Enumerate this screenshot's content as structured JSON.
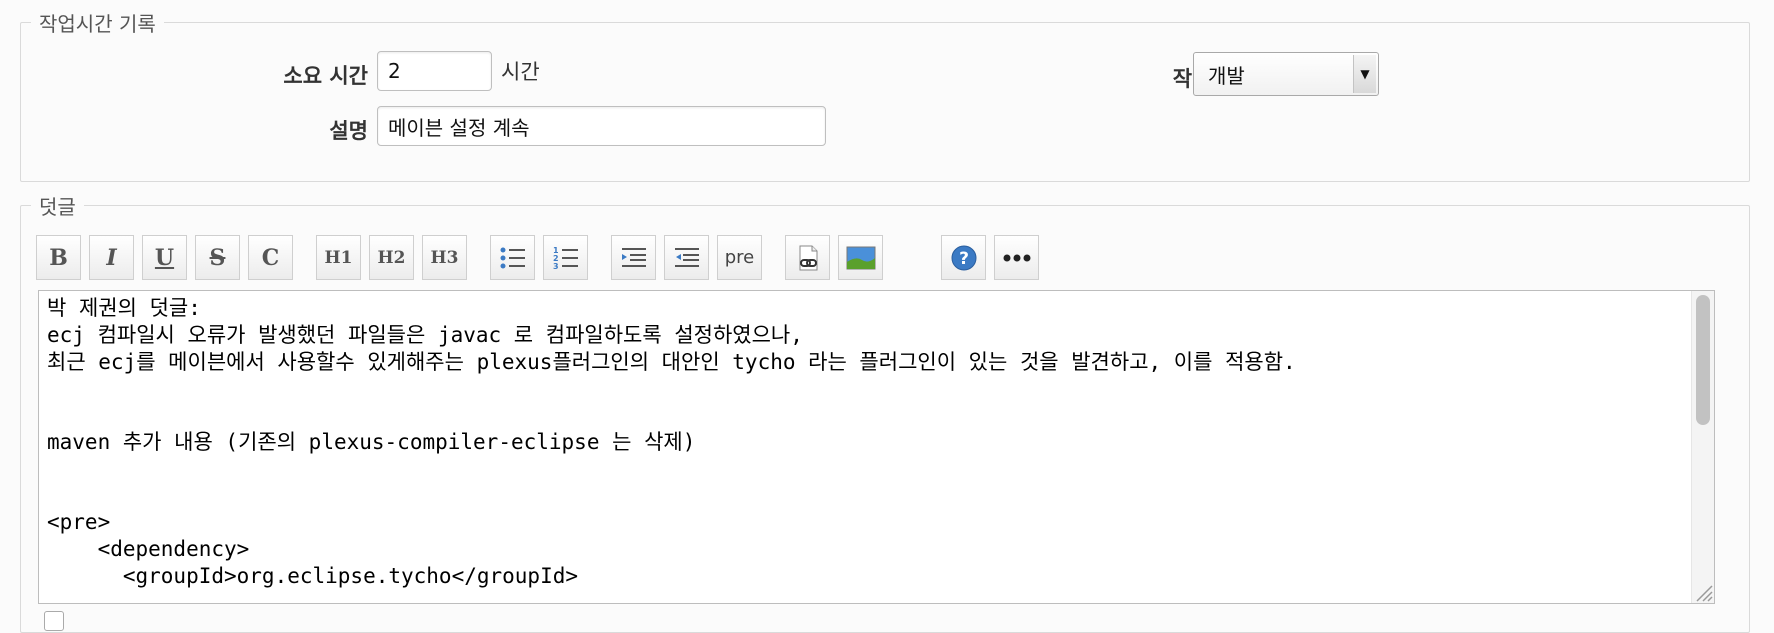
{
  "timelog": {
    "legend": "작업시간 기록",
    "hours_label": "소요 시간",
    "hours_value": "2",
    "hours_unit": "시간",
    "activity_label": "작업종류",
    "activity_value": "개발",
    "comment_label": "설명",
    "comment_value": "메이븐 설정 계속"
  },
  "notes": {
    "legend": "덧글",
    "toolbar": [
      {
        "name": "bold-button",
        "label": "B"
      },
      {
        "name": "italic-button",
        "label": "I"
      },
      {
        "name": "underline-button",
        "label": "U"
      },
      {
        "name": "strike-button",
        "label": "S"
      },
      {
        "name": "code-button",
        "label": "C"
      },
      {
        "name": "heading1-button",
        "label": "H1"
      },
      {
        "name": "heading2-button",
        "label": "H2"
      },
      {
        "name": "heading3-button",
        "label": "H3"
      },
      {
        "name": "unordered-list-button",
        "icon": "bullet-list-icon"
      },
      {
        "name": "ordered-list-button",
        "icon": "numbered-list-icon"
      },
      {
        "name": "indent-button",
        "icon": "indent-icon"
      },
      {
        "name": "outdent-button",
        "icon": "outdent-icon"
      },
      {
        "name": "pre-button",
        "label": "pre"
      },
      {
        "name": "link-button",
        "icon": "link-icon"
      },
      {
        "name": "image-button",
        "icon": "image-icon"
      },
      {
        "name": "help-button",
        "icon": "help-icon"
      },
      {
        "name": "more-button",
        "icon": "more-icon"
      }
    ],
    "editor_text": "박 제권의 덧글:\necj 컴파일시 오류가 발생했던 파일들은 javac 로 컴파일하도록 설정하였으나,\n최근 ecj를 메이븐에서 사용할수 있게해주는 plexus플러그인의 대안인 tycho 라는 플러그인이 있는 것을 발견하고, 이를 적용함.\n\n\nmaven 추가 내용 (기존의 plexus-compiler-eclipse 는 삭제)\n\n\n<pre>\n    <dependency>\n      <groupId>org.eclipse.tycho</groupId>"
  },
  "colors": {
    "border": "#dadada",
    "help_icon": "#3b7ac4",
    "image_icon_sky": "#4a90d9",
    "image_icon_grass": "#5aa02c"
  }
}
